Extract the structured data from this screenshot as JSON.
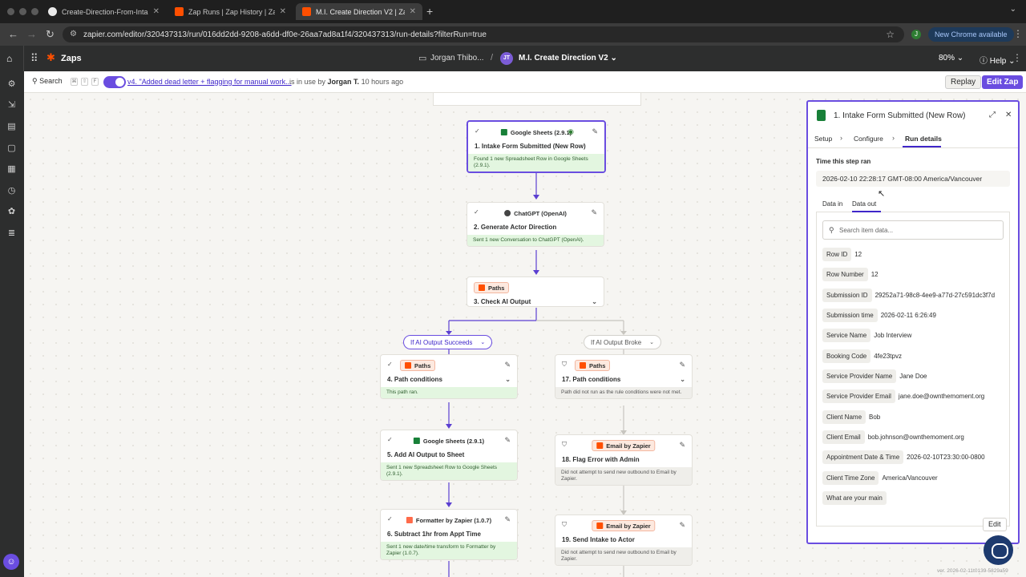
{
  "browser": {
    "tabs": [
      {
        "title": "Create-Direction-From-Intake",
        "favicon_color": "#eaeaea"
      },
      {
        "title": "Zap Runs | Zap History | Zapier",
        "favicon_color": "#ff4f00"
      },
      {
        "title": "M.I. Create Direction V2 | Zapier",
        "favicon_color": "#ff4f00"
      }
    ],
    "url": "zapier.com/editor/320437313/run/016dd2dd-9208-a6dd-df0e-26aa7ad8a1f4/320437313/run-details?filterRun=true",
    "profile_initial": "J",
    "new_chrome_label": "New Chrome available"
  },
  "header": {
    "zaps_label": "Zaps",
    "folder_name": "Jorgan Thibo...",
    "avatar_initials": "JT",
    "zap_name": "M.I. Create Direction V2",
    "zoom": "80%",
    "help_label": "Help"
  },
  "subbar": {
    "search_label": "Search",
    "kbd": [
      "⌘",
      "⇧",
      "F"
    ],
    "version_text": "v4. \"Added dead letter + flagging for manual work...",
    "in_use_prefix": "is in use by",
    "in_use_user": "Jorgan T.",
    "in_use_time": "10 hours ago",
    "replay_label": "Replay",
    "edit_zap_label": "Edit Zap"
  },
  "steps": [
    {
      "app": "Google Sheets (2.9.1)",
      "title": "1. Intake Form Submitted (New Row)",
      "footer": "Found 1 new Spreadsheet Row in Google Sheets (2.9.1)."
    },
    {
      "app": "ChatGPT (OpenAI)",
      "title": "2. Generate Actor Direction",
      "footer": "Sent 1 new Conversation to ChatGPT (OpenAI)."
    },
    {
      "app": "Paths",
      "title": "3. Check AI Output"
    },
    {
      "app": "Paths",
      "title": "4. Path conditions",
      "footer": "This path ran."
    },
    {
      "app": "Google Sheets (2.9.1)",
      "title": "5. Add AI Output to Sheet",
      "footer": "Sent 1 new Spreadsheet Row to Google Sheets (2.9.1)."
    },
    {
      "app": "Formatter by Zapier (1.0.7)",
      "title": "6. Subtract 1hr from Appt Time",
      "footer": "Sent 1 new date/time transform to Formatter by Zapier (1.0.7)."
    },
    {
      "app": "Paths",
      "title": "17. Path conditions",
      "footer": "Path did not run as the rule conditions were not met."
    },
    {
      "app": "Email by Zapier",
      "title": "18. Flag Error with Admin",
      "footer": "Did not attempt to send new outbound to Email by Zapier."
    },
    {
      "app": "Email by Zapier",
      "title": "19. Send Intake to Actor",
      "footer": "Did not attempt to send new outbound to Email by Zapier."
    }
  ],
  "paths": {
    "succeeds": "If AI Output Succeeds",
    "broke": "If AI Output Broke"
  },
  "panel": {
    "title": "1. Intake Form Submitted (New Row)",
    "tabs": [
      "Setup",
      "Configure",
      "Run details"
    ],
    "time_label": "Time this step ran",
    "time_value": "2026-02-10 22:28:17 GMT-08:00 America/Vancouver",
    "subtabs": [
      "Data in",
      "Data out"
    ],
    "search_placeholder": "Search item data...",
    "rows": [
      {
        "key": "Row ID",
        "value": "12"
      },
      {
        "key": "Row Number",
        "value": "12"
      },
      {
        "key": "Submission ID",
        "value": "29252a71-98c8-4ee9-a77d-27c591dc3f7d"
      },
      {
        "key": "Submission time",
        "value": "2026-02-11 6:26:49"
      },
      {
        "key": "Service Name",
        "value": "Job Interview"
      },
      {
        "key": "Booking Code",
        "value": "4fe23tpvz"
      },
      {
        "key": "Service Provider Name",
        "value": "Jane Doe"
      },
      {
        "key": "Service Provider Email",
        "value": "jane.doe@ownthemoment.org"
      },
      {
        "key": "Client Name",
        "value": "Bob"
      },
      {
        "key": "Client Email",
        "value": "bob.johnson@ownthemoment.org"
      },
      {
        "key": "Appointment Date & Time",
        "value": "2026-02-10T23:30:00-0800"
      },
      {
        "key": "Client Time Zone",
        "value": "America/Vancouver"
      },
      {
        "key": "What are your main",
        "value": ""
      }
    ],
    "edit_label": "Edit"
  },
  "footer_version": "ver. 2026-02-11t0139-5829a59"
}
